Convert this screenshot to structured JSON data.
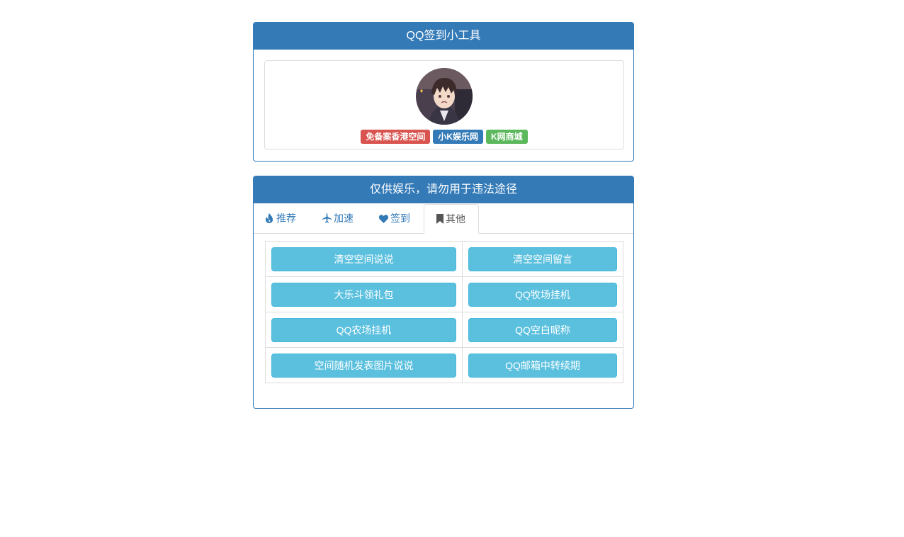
{
  "top_panel": {
    "title": "QQ签到小工具",
    "badges": [
      "免备案香港空间",
      "小K娱乐网",
      "K网商城"
    ]
  },
  "tool_panel": {
    "title": "仅供娱乐，请勿用于违法途径",
    "tabs": [
      {
        "label": "推荐",
        "icon": "fire-icon"
      },
      {
        "label": "加速",
        "icon": "plane-icon"
      },
      {
        "label": "签到",
        "icon": "heart-icon"
      },
      {
        "label": "其他",
        "icon": "bookmark-icon"
      }
    ],
    "active_tab": "其他",
    "buttons": [
      [
        "清空空间说说",
        "清空空间留言"
      ],
      [
        "大乐斗领礼包",
        "QQ牧场挂机"
      ],
      [
        "QQ农场挂机",
        "QQ空白昵称"
      ],
      [
        "空间随机发表图片说说",
        "QQ邮箱中转续期"
      ]
    ]
  },
  "colors": {
    "primary": "#337ab7",
    "info": "#5bc0de",
    "danger": "#d9534f",
    "success": "#5cb85c"
  }
}
